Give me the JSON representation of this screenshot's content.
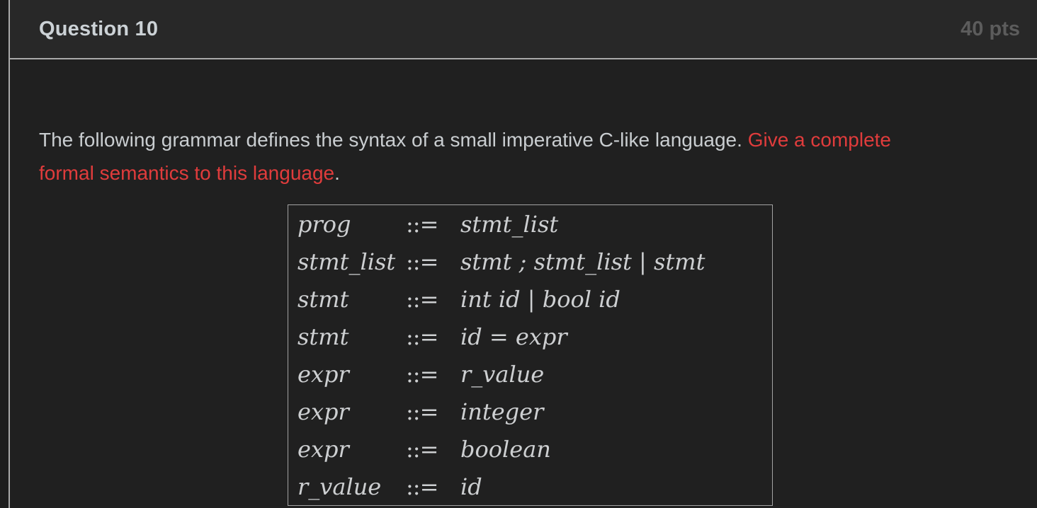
{
  "header": {
    "title": "Question 10",
    "points": "40 pts"
  },
  "question": {
    "sentence_normal": "The following grammar defines the syntax of a small imperative C-like language. ",
    "sentence_red_line1": "Give a complete",
    "sentence_red_line2": "formal semantics to this language",
    "trailing_period": "."
  },
  "grammar": {
    "rows": [
      {
        "lhs": "prog",
        "op": "::=",
        "rhs": "stmt_list"
      },
      {
        "lhs": "stmt_list",
        "op": "::=",
        "rhs": "stmt ; stmt_list | stmt"
      },
      {
        "lhs": "stmt",
        "op": "::=",
        "rhs": "int id | bool id"
      },
      {
        "lhs": "stmt",
        "op": "::=",
        "rhs": "id = expr"
      },
      {
        "lhs": "expr",
        "op": "::=",
        "rhs": "r_value"
      },
      {
        "lhs": "expr",
        "op": "::=",
        "rhs": "integer"
      },
      {
        "lhs": "expr",
        "op": "::=",
        "rhs": "boolean"
      },
      {
        "lhs": "r_value",
        "op": "::=",
        "rhs": "id"
      }
    ]
  },
  "colors": {
    "page_background": "#1d1d1d",
    "card_background": "#202020",
    "header_background": "#282828",
    "border": "#a9a9a9",
    "title_text": "#ccd2d6",
    "points_text": "#5c5c5c",
    "body_text": "#c9cdd0",
    "highlight_red": "#e03c3c",
    "table_text": "#cdcfd1"
  }
}
